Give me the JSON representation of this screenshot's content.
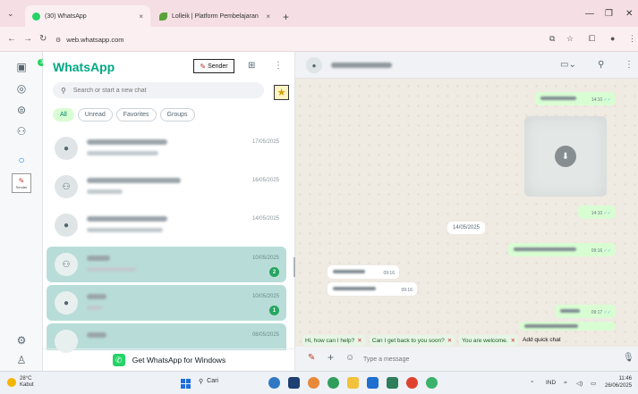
{
  "browser": {
    "tabs": [
      {
        "title": "(30) WhatsApp",
        "close": "×"
      },
      {
        "title": "Lolleik | Platform Pembelajaran",
        "close": "×"
      }
    ],
    "new_tab": "+",
    "url": "web.whatsapp.com"
  },
  "rail": {
    "badge": "30",
    "sender_label": "Sender"
  },
  "list": {
    "brand": "WhatsApp",
    "sender_button": "Sender",
    "search_placeholder": "Search or start a new chat",
    "filters": [
      "All",
      "Unread",
      "Favorites",
      "Groups"
    ],
    "chats": [
      {
        "time": "17/05/2025",
        "unread": "",
        "selected": false,
        "avatar": "person-icon"
      },
      {
        "time": "16/05/2025",
        "unread": "",
        "selected": false,
        "avatar": "group-icon"
      },
      {
        "time": "14/05/2025",
        "unread": "",
        "selected": false,
        "avatar": "person-icon"
      },
      {
        "time": "10/05/2025",
        "unread": "2",
        "selected": true,
        "avatar": "group-icon"
      },
      {
        "time": "10/05/2025",
        "unread": "1",
        "selected": true,
        "avatar": "person-icon"
      },
      {
        "time": "08/05/2025",
        "unread": "",
        "selected": true,
        "avatar": "photo"
      }
    ],
    "get_app": "Get WhatsApp for Windows"
  },
  "conversation": {
    "messages": [
      {
        "time": "14:10",
        "out": true
      },
      {
        "time": "14:10",
        "out": true
      },
      {
        "time": "09:16",
        "out": true
      },
      {
        "time": "09:16",
        "out": false
      },
      {
        "time": "09:16",
        "out": false
      },
      {
        "time": "09:17",
        "out": true
      }
    ],
    "date_separator": "14/05/2025",
    "quick_replies": [
      "Hi, how can I help?",
      "Can I get back to you soon?",
      "You are welcome."
    ],
    "quick_add": "Add quick chat",
    "composer_placeholder": "Type a message"
  },
  "taskbar": {
    "temp": "28°C",
    "weather": "Kabut",
    "search": "Cari",
    "lang": "IND",
    "time": "11:46",
    "date": "26/06/2025"
  },
  "colors": {
    "brand": "#00a884",
    "selected_row": "#b8ddd8",
    "bubble_out": "#d9fdd3"
  }
}
